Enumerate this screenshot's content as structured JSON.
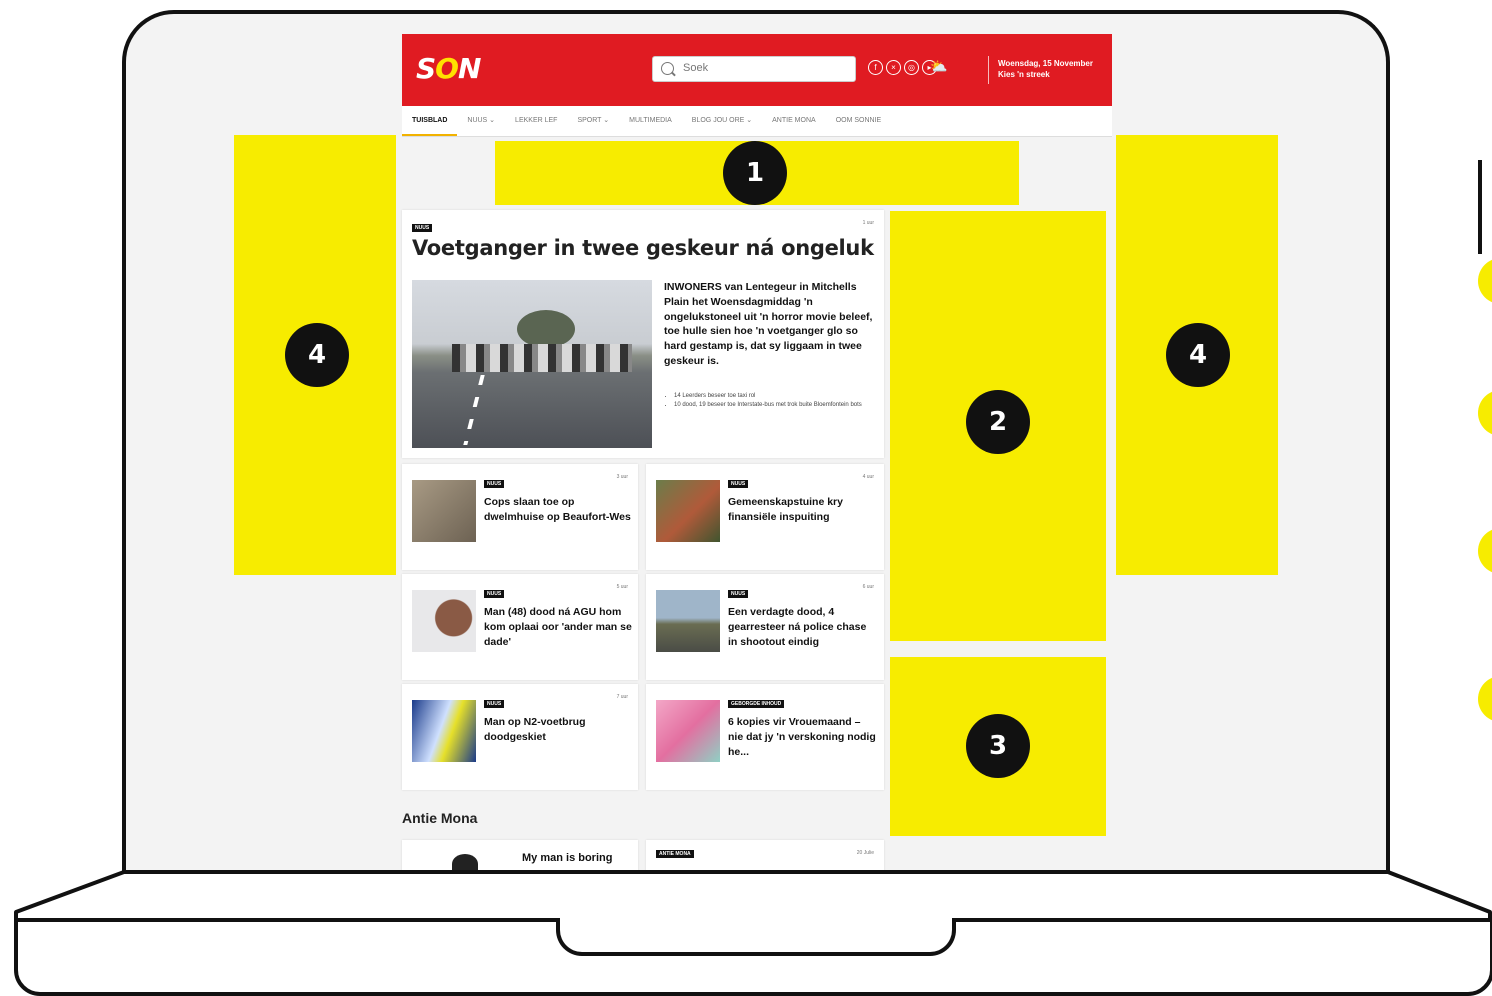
{
  "site": {
    "logo_text_1": "S",
    "logo_text_2": "O",
    "logo_text_3": "N",
    "search_placeholder": "Soek",
    "date_line1": "Woensdag, 15 November",
    "date_line2": "Kies 'n streek",
    "nav": [
      "TUISBLAD",
      "NUUS ⌄",
      "LEKKER LEF",
      "SPORT ⌄",
      "MULTIMEDIA",
      "BLOG JOU ORE ⌄",
      "ANTIE MONA",
      "OOM SONNIE"
    ],
    "lead": {
      "tag": "NUUS",
      "time": "1 uur",
      "title": "Voetganger in twee geskeur ná ongeluk",
      "summary": "INWONERS van Lentegeur in Mitchells Plain het Woensdagmiddag 'n ongelukstoneel uit 'n horror movie beleef, toe hulle sien hoe 'n voetganger glo so hard gestamp is, dat sy liggaam in twee geskeur is.",
      "bullets": [
        "14 Leerders beseer toe taxi rol",
        "10 dood, 19 beseer toe Interstate-bus met trok buite Bloemfontein bots"
      ]
    },
    "articles": [
      {
        "tag": "NUUS",
        "time": "3 uur",
        "title": "Cops slaan toe op dwelmhuise op Beaufort-Wes"
      },
      {
        "tag": "NUUS",
        "time": "4 uur",
        "title": "Gemeenskapstuine kry finansiële inspuiting"
      },
      {
        "tag": "NUUS",
        "time": "5 uur",
        "title": "Man (48) dood ná AGU hom kom oplaai oor 'ander man se dade'"
      },
      {
        "tag": "NUUS",
        "time": "6 uur",
        "title": "Een verdagte dood, 4 gearresteer ná police chase in shootout eindig"
      },
      {
        "tag": "NUUS",
        "time": "7 uur",
        "title": "Man op N2-voetbrug doodgeskiet"
      },
      {
        "tag": "GEBORGDE INHOUD",
        "time": "",
        "title": "6 kopies vir Vrouemaand – nie dat jy 'n verskoning nodig he..."
      }
    ],
    "section_title": "Antie Mona",
    "mona_card_title": "My man is boring",
    "mona_tag": "ANTIE MONA",
    "mona_time": "20 Julie"
  },
  "zones": {
    "z1": "1",
    "z2": "2",
    "z3": "3",
    "z4a": "4",
    "z4b": "4"
  },
  "colors": {
    "header_red": "#e01b22",
    "zone_yellow": "#f7ec00"
  }
}
